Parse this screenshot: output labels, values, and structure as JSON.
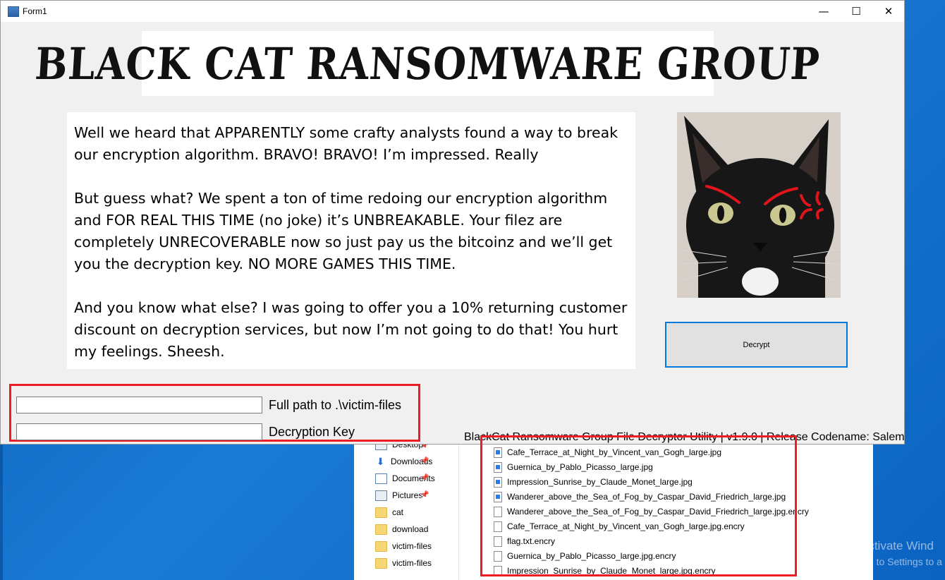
{
  "form": {
    "title": "Form1",
    "controls": {
      "minimize": "—",
      "maximize": "☐",
      "close": "✕"
    },
    "banner": "BLACK CAT RANSOMWARE GROUP",
    "message": [
      "Well we heard that APPARENTLY some crafty analysts found a way to break our encryption algorithm. BRAVO! BRAVO! I’m impressed. Really",
      "But guess what? We spent a ton of time redoing our encryption algorithm and FOR REAL THIS TIME (no joke) it’s UNBREAKABLE. Your filez are completely UNRECOVERABLE now so just pay us the bitcoinz and we’ll get you the decryption key. NO MORE GAMES THIS TIME.",
      "And you know what else? I was going to offer you a 10% returning customer discount on decryption services, but now I’m not going to do that! You hurt my feelings. Sheesh."
    ],
    "decrypt_button": "Decrypt",
    "path_field": {
      "value": "",
      "label": "Full path to .\\victim-files"
    },
    "key_field": {
      "value": "",
      "label": "Decryption Key"
    },
    "status": "BlackCat Ransomware Group File Decryptor Utility | v1.9.0 | Release Codename: Salem",
    "accent_color": "#0078d7",
    "highlight_color": "#ee1c24"
  },
  "explorer": {
    "nav_items": [
      {
        "label": "Desktop",
        "icon": "desktop-icon",
        "pinned": true
      },
      {
        "label": "Downloads",
        "icon": "download-arrow-icon",
        "pinned": true
      },
      {
        "label": "Documents",
        "icon": "documents-icon",
        "pinned": true
      },
      {
        "label": "Pictures",
        "icon": "pictures-icon",
        "pinned": true
      },
      {
        "label": "cat",
        "icon": "folder-icon",
        "pinned": false
      },
      {
        "label": "download",
        "icon": "folder-icon",
        "pinned": false
      },
      {
        "label": "victim-files",
        "icon": "folder-icon",
        "pinned": false
      },
      {
        "label": "victim-files",
        "icon": "folder-icon",
        "pinned": false
      }
    ],
    "files": [
      {
        "name": "Cafe_Terrace_at_Night_by_Vincent_van_Gogh_large.jpg",
        "type": "image"
      },
      {
        "name": "Guernica_by_Pablo_Picasso_large.jpg",
        "type": "image"
      },
      {
        "name": "Impression_Sunrise_by_Claude_Monet_large.jpg",
        "type": "image"
      },
      {
        "name": "Wanderer_above_the_Sea_of_Fog_by_Caspar_David_Friedrich_large.jpg",
        "type": "image"
      },
      {
        "name": "Wanderer_above_the_Sea_of_Fog_by_Caspar_David_Friedrich_large.jpg.encry",
        "type": "file"
      },
      {
        "name": "Cafe_Terrace_at_Night_by_Vincent_van_Gogh_large.jpg.encry",
        "type": "file"
      },
      {
        "name": "flag.txt.encry",
        "type": "file"
      },
      {
        "name": "Guernica_by_Pablo_Picasso_large.jpg.encry",
        "type": "file"
      },
      {
        "name": "Impression_Sunrise_by_Claude_Monet_large.jpg.encry",
        "type": "file"
      }
    ]
  },
  "watermark": {
    "line1": "Activate Wind",
    "line2": "Go to Settings to a"
  }
}
